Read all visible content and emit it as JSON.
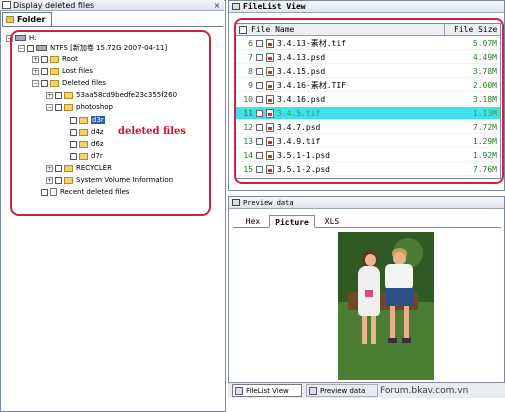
{
  "left_panel": {
    "title": "Display deleted files",
    "close_glyph": "×",
    "tab_label": "Folder"
  },
  "tree": {
    "drive": "H:",
    "ntfs": "NTFS [新加卷 15.72G 2007-04-11]",
    "root": "Root",
    "lost_files": "Lost files",
    "deleted_files": "Deleted files",
    "hash_folder": "53aa58cd9bedfe23c355f260",
    "photoshop": "photoshop",
    "d3r": "d3r",
    "d4z": "d4z",
    "d6z": "d6z",
    "d7r": "d7r",
    "recycler": "RECYCLER",
    "system_volume": "System Volume Information",
    "recent_deleted": "Recent deleted files"
  },
  "annotation": {
    "deleted_files_label": "deleted files",
    "highlight_color": "#cc2244"
  },
  "file_list": {
    "title": "FileList View",
    "header_name": "File Name",
    "header_size": "File Size",
    "rows": [
      {
        "num": "6",
        "name": "3.4.13-素材.tif",
        "size": "5.07M",
        "selected": false
      },
      {
        "num": "7",
        "name": "3.4.13.psd",
        "size": "4.49M",
        "selected": false
      },
      {
        "num": "8",
        "name": "3.4.15.psd",
        "size": "3.78M",
        "selected": false
      },
      {
        "num": "9",
        "name": "3.4.16-素材.TIF",
        "size": "2.00M",
        "selected": false
      },
      {
        "num": "10",
        "name": "3.4.16.psd",
        "size": "3.18M",
        "selected": false
      },
      {
        "num": "11",
        "name": "3.4.5.tif",
        "size": "1.13M",
        "selected": true
      },
      {
        "num": "12",
        "name": "3.4.7.psd",
        "size": "7.72M",
        "selected": false
      },
      {
        "num": "13",
        "name": "3.4.9.tif",
        "size": "1.29M",
        "selected": false
      },
      {
        "num": "14",
        "name": "3.5.1-1.psd",
        "size": "1.92M",
        "selected": false
      },
      {
        "num": "15",
        "name": "3.5.1-2.psd",
        "size": "7.76M",
        "selected": false
      }
    ],
    "selected_color": "#3fe0ea"
  },
  "preview": {
    "title": "Preview data",
    "tabs": {
      "hex": "Hex",
      "picture": "Picture",
      "xls": "XLS"
    },
    "active_tab": "Picture"
  },
  "bottom_tabs": {
    "filelist": "FileList View",
    "preview": "Preview data"
  },
  "watermark": "Forum.bkav.com.vn"
}
